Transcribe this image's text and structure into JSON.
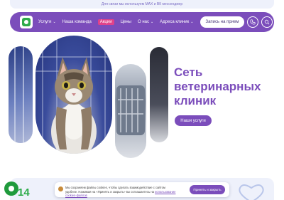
{
  "top_notice": {
    "text": "Для связи мы используем MAX и ВК мессенджер"
  },
  "navbar": {
    "items": [
      {
        "label": "Услуги",
        "dropdown": true
      },
      {
        "label": "Наша команда",
        "dropdown": false
      },
      {
        "label": "Акции",
        "dropdown": false
      },
      {
        "label": "Цены",
        "dropdown": false
      },
      {
        "label": "О нас",
        "dropdown": true
      },
      {
        "label": "Адреса клиник",
        "dropdown": true
      }
    ],
    "cta_label": "Запись на прием",
    "phone_icon": "phone-icon",
    "search_icon": "search-icon"
  },
  "hero": {
    "title_line1": "Сеть",
    "title_line2": "ветеринарных",
    "title_line3": "клиник",
    "button_label": "Наши услуги"
  },
  "bottom": {
    "number": "14"
  },
  "cookie_banner": {
    "text_part1": "Мы сохраняем файлы cookies, чтобы сделать взаимодействие с сайтом удобнее. Нажимая на «Принять и закрыть» вы соглашаетесь на",
    "link_text": "использование cookies-файлов",
    "button_label": "Принять и закрыть"
  },
  "colors": {
    "brand_purple": "#7b4dbb",
    "accent_pink": "#e0428a",
    "brand_green": "#2eab4a"
  }
}
